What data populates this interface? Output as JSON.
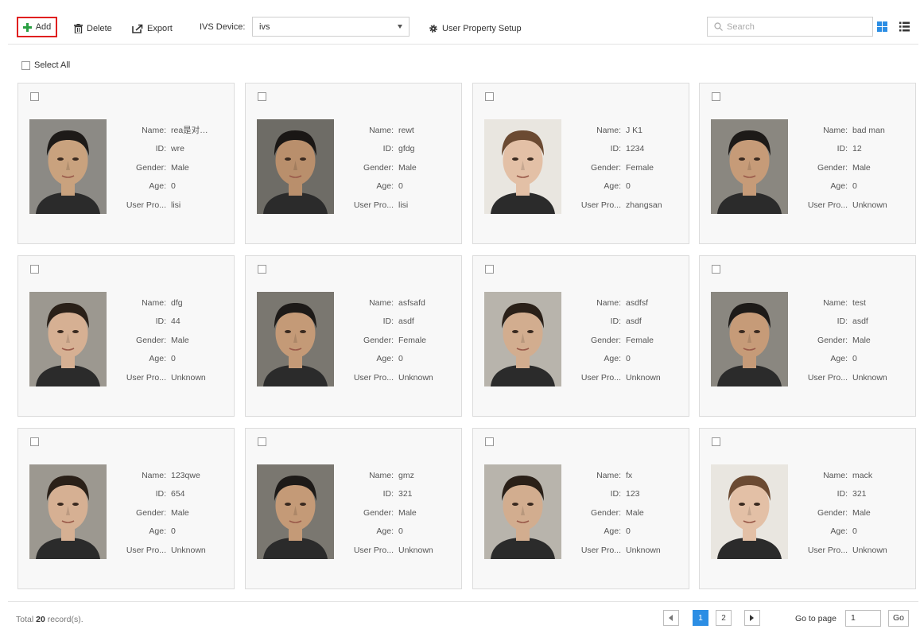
{
  "toolbar": {
    "add_label": "Add",
    "delete_label": "Delete",
    "export_label": "Export",
    "ivs_device_label": "IVS Device:",
    "ivs_device_value": "ivs",
    "user_property_setup_label": "User Property Setup",
    "search_placeholder": "Search"
  },
  "select_all_label": "Select All",
  "field_labels": {
    "name": "Name:",
    "id": "ID:",
    "gender": "Gender:",
    "age": "Age:",
    "user_property": "User Pro..."
  },
  "cards": [
    {
      "name": "rea是对…",
      "id": "wre",
      "gender": "Male",
      "age": "0",
      "user_property": "lisi"
    },
    {
      "name": "rewt",
      "id": "gfdg",
      "gender": "Male",
      "age": "0",
      "user_property": "lisi"
    },
    {
      "name": "J K1",
      "id": "1234",
      "gender": "Female",
      "age": "0",
      "user_property": "zhangsan"
    },
    {
      "name": "bad man",
      "id": "12",
      "gender": "Male",
      "age": "0",
      "user_property": "Unknown"
    },
    {
      "name": "dfg",
      "id": "44",
      "gender": "Male",
      "age": "0",
      "user_property": "Unknown"
    },
    {
      "name": "asfsafd",
      "id": "asdf",
      "gender": "Female",
      "age": "0",
      "user_property": "Unknown"
    },
    {
      "name": "asdfsf",
      "id": "asdf",
      "gender": "Female",
      "age": "0",
      "user_property": "Unknown"
    },
    {
      "name": "test",
      "id": "asdf",
      "gender": "Male",
      "age": "0",
      "user_property": "Unknown"
    },
    {
      "name": "123qwe",
      "id": "654",
      "gender": "Male",
      "age": "0",
      "user_property": "Unknown"
    },
    {
      "name": "gmz",
      "id": "321",
      "gender": "Male",
      "age": "0",
      "user_property": "Unknown"
    },
    {
      "name": "fx",
      "id": "123",
      "gender": "Male",
      "age": "0",
      "user_property": "Unknown"
    },
    {
      "name": "mack",
      "id": "321",
      "gender": "Male",
      "age": "0",
      "user_property": "Unknown"
    }
  ],
  "footer": {
    "total_prefix": "Total",
    "total_count": "20",
    "total_suffix": "record(s).",
    "pages": [
      "1",
      "2"
    ],
    "current_page": "1",
    "goto_label": "Go to page",
    "goto_value": "1",
    "go_label": "Go"
  },
  "colors": {
    "accent": "#2c8ee4",
    "add_icon": "#2aa043",
    "highlight_border": "#e02020",
    "card_bg": "#f8f8f8"
  },
  "icons": {
    "add": "plus-icon",
    "delete": "trash-icon",
    "export": "export-icon",
    "property_setup": "gear-icon",
    "search": "search-icon",
    "grid_view": "grid-view-icon",
    "list_view": "list-view-icon"
  }
}
